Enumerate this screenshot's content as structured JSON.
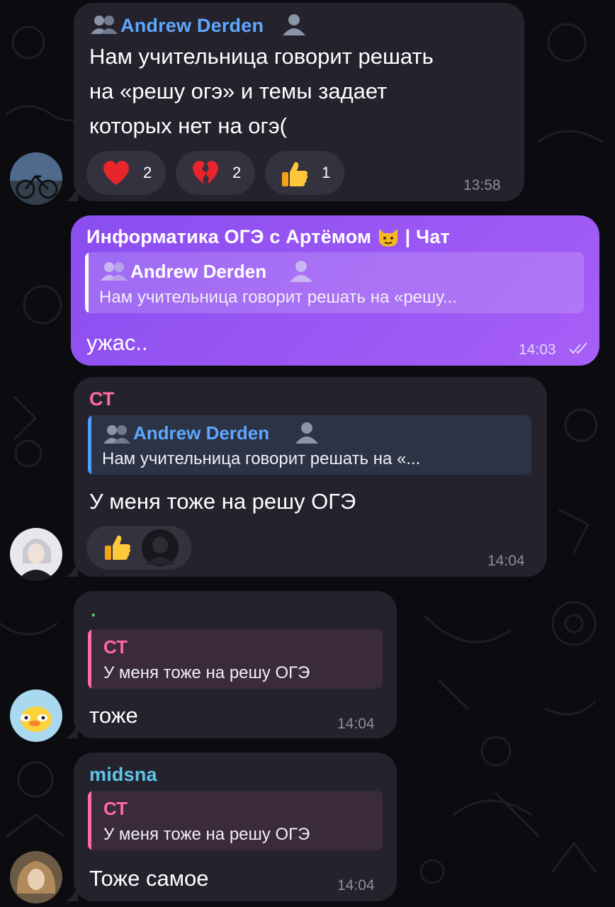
{
  "colors": {
    "background": "#0b0b10",
    "incoming_bubble": "#24232d",
    "outgoing_bubble": "#9a56f3",
    "name_blue": "#5ea7ff",
    "name_pink": "#ff6aa0",
    "name_teal": "#5ec4e8",
    "time": "#8e8c99"
  },
  "messages": [
    {
      "sender": "Andrew Derden",
      "lines": [
        "Нам учительница говорит решать",
        "на «решу огэ» и темы задает",
        "которых нет на огэ("
      ],
      "reactions": [
        {
          "emoji": "red-heart",
          "count": "2"
        },
        {
          "emoji": "broken-heart",
          "count": "2"
        },
        {
          "emoji": "thumbs-up",
          "count": "1"
        }
      ],
      "time": "13:58"
    },
    {
      "chat_title": "Информатика ОГЭ с Артёмом",
      "chat_suffix": "| Чат",
      "reply_name": "Andrew Derden",
      "reply_text": "Нам учительница говорит решать на «решу...",
      "text": "ужас..",
      "time": "14:03"
    },
    {
      "sender": "СТ",
      "reply_name": "Andrew Derden",
      "reply_text": "Нам учительница говорит решать на «...",
      "text": "У меня тоже на решу ОГЭ",
      "reactions": [
        {
          "emoji": "thumbs-up"
        }
      ],
      "time": "14:04"
    },
    {
      "sender": ".",
      "reply_name": "СТ",
      "reply_text": "У меня тоже на решу ОГЭ",
      "text": "тоже",
      "time": "14:04"
    },
    {
      "sender": "midsna",
      "reply_name": "СТ",
      "reply_text": "У меня тоже на решу ОГЭ",
      "text": "Тоже самое",
      "time": "14:04"
    }
  ]
}
